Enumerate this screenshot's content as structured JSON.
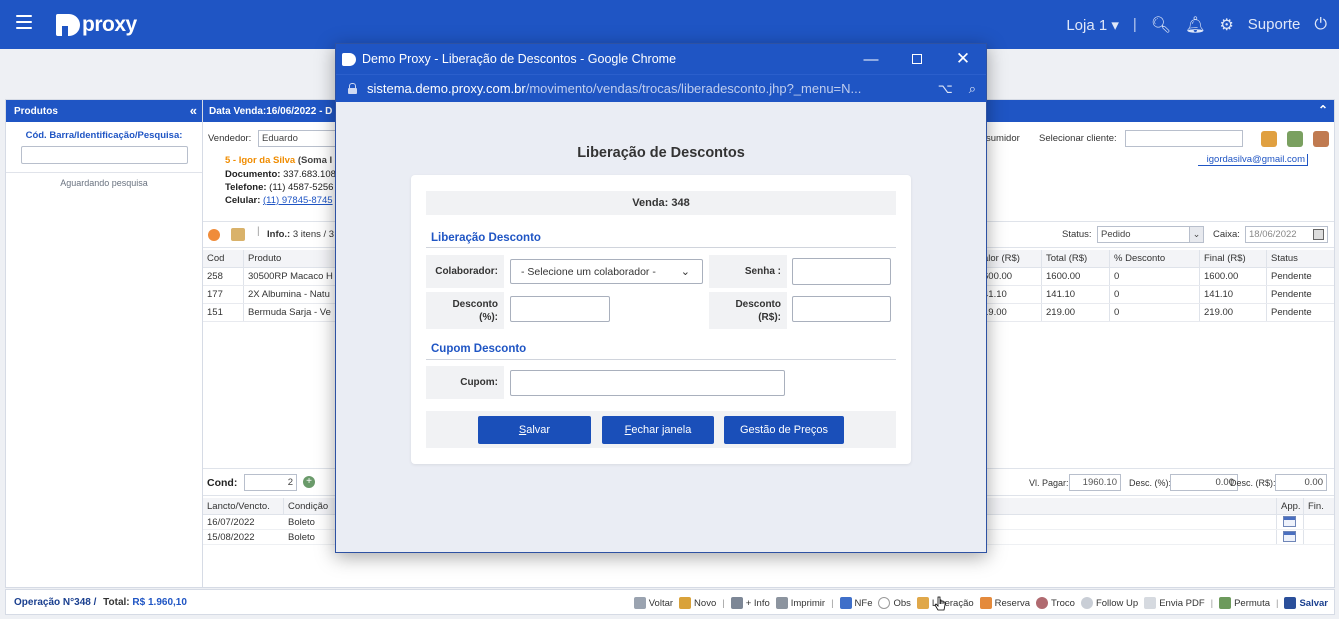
{
  "topbar": {
    "logo_text": "proxy",
    "store": "Loja 1 ▾",
    "support": "Suporte"
  },
  "left_panel": {
    "title": "Produtos",
    "search_label": "Cód. Barra/Identificação/Pesquisa:",
    "status": "Aguardando pesquisa"
  },
  "main": {
    "header": "Data Venda:16/06/2022 - D",
    "vendedor_label": "Vendedor:",
    "vendedor_value": "Eduardo",
    "client_name": "5 - Igor da Silva",
    "client_soma": "(Soma I",
    "documento_label": "Documento:",
    "documento_value": "337.683.108",
    "telefone_label": "Telefone:",
    "telefone_value": "(11) 4587-5256",
    "celular_label": "Celular:",
    "celular_value": "(11) 97845-8745",
    "consumidor_label": "sumidor",
    "select_client_label": "Selecionar cliente:",
    "email": "igordasilva@gmail.com",
    "info_label": "Info.:",
    "info_value": "3 itens / 3",
    "status_label": "Status:",
    "status_value": "Pedido",
    "caixa_label": "Caixa:",
    "caixa_value": "18/06/2022",
    "grid_headers": [
      "Cod",
      "Produto",
      "alor (R$)",
      "Total (R$)",
      "% Desconto",
      "Final (R$)",
      "Status"
    ],
    "grid_rows": [
      [
        "258",
        "30500RP Macaco H",
        "600.00",
        "1600.00",
        "0",
        "1600.00",
        "Pendente"
      ],
      [
        "177",
        "2X Albumina - Natu",
        "41.10",
        "141.10",
        "0",
        "141.10",
        "Pendente"
      ],
      [
        "151",
        "Bermuda Sarja - Ve",
        "19.00",
        "219.00",
        "0",
        "219.00",
        "Pendente"
      ]
    ],
    "cond_label": "Cond:",
    "cond_value": "2",
    "vl_pagar_label": "Vl. Pagar:",
    "vl_pagar_value": "1960.10",
    "desc_pct_label": "Desc. (%):",
    "desc_pct_value": "0.00",
    "desc_rs_label": "Desc. (R$):",
    "desc_rs_value": "0.00",
    "pay_headers": [
      "Lancto/Vencto.",
      "Condição",
      "App.",
      "Fin."
    ],
    "pay_rows": [
      [
        "16/07/2022",
        "Boleto"
      ],
      [
        "15/08/2022",
        "Boleto"
      ]
    ]
  },
  "bottombar": {
    "operacao": "Operação N°348 /",
    "total_label": "Total:",
    "total_value": "R$ 1.960,10",
    "items": [
      "Voltar",
      "Novo",
      "+ Info",
      "Imprimir",
      "NFe",
      "Obs",
      "Liberação",
      "Reserva",
      "Troco",
      "Follow Up",
      "Envia PDF",
      "Permuta",
      "Salvar"
    ]
  },
  "popup": {
    "window_title": "Demo Proxy - Liberação de Descontos - Google Chrome",
    "url_host": "sistema.demo.proxy.com.br",
    "url_path": "/movimento/vendas/trocas/liberadesconto.jhp?_menu=N...",
    "title": "Liberação de Descontos",
    "venda": "Venda: 348",
    "section_desconto": "Liberação Desconto",
    "colaborador_label": "Colaborador:",
    "colaborador_placeholder": "- Selecione um colaborador -",
    "senha_label": "Senha :",
    "desconto_pct_label_1": "Desconto",
    "desconto_pct_label_2": "(%):",
    "desconto_rs_label_1": "Desconto",
    "desconto_rs_label_2": "(R$):",
    "section_cupom": "Cupom Desconto",
    "cupom_label": "Cupom:",
    "btn_salvar_first": "S",
    "btn_salvar_rest": "alvar",
    "btn_fechar_first": "F",
    "btn_fechar_rest": "echar janela",
    "btn_gestao": "Gestão de Preços"
  },
  "colors": {
    "brand_blue": "#1f55c4",
    "client_orange": "#f08c00"
  }
}
